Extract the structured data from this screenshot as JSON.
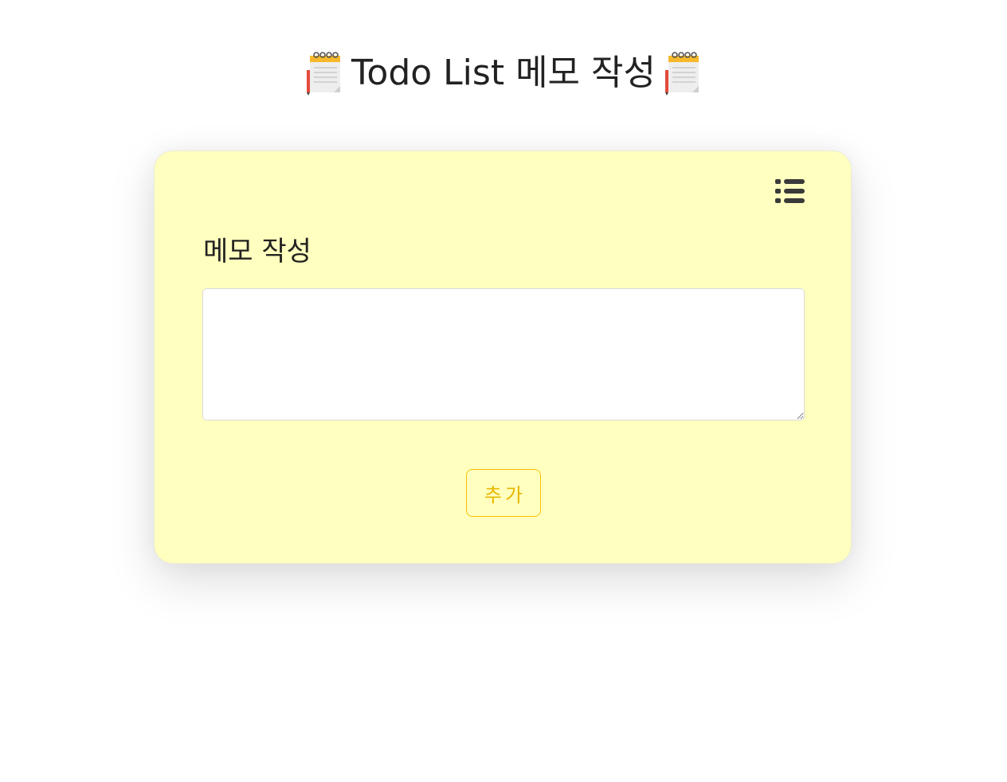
{
  "header": {
    "title": "Todo List 메모 작성",
    "left_icon": "notepad-icon",
    "right_icon": "notepad-icon"
  },
  "memo_card": {
    "background_color": "#ffffbf",
    "list_button_icon": "list-icon",
    "heading": "메모 작성",
    "textarea": {
      "value": "",
      "placeholder": ""
    },
    "add_button_label": "추가",
    "accent_color": "#f2c200"
  }
}
